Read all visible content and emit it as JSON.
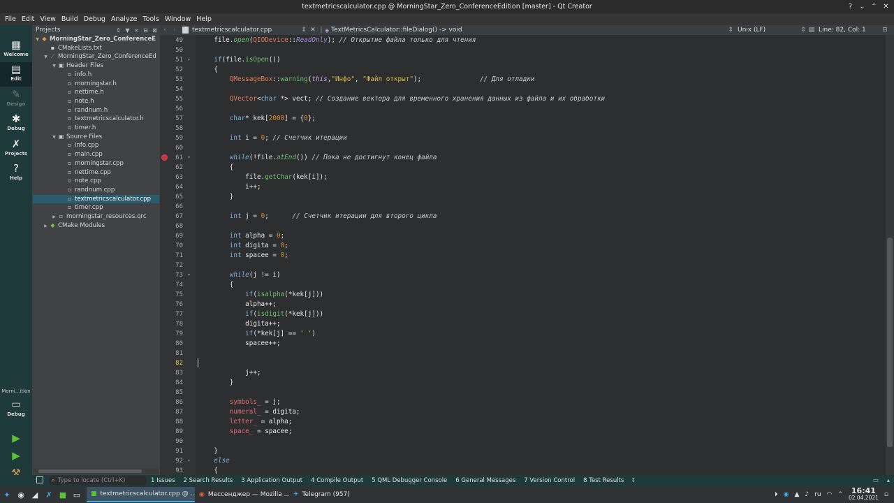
{
  "window": {
    "title": "textmetricscalculator.cpp @ MorningStar_Zero_ConferenceEdition [master] - Qt Creator"
  },
  "menu": [
    "File",
    "Edit",
    "View",
    "Build",
    "Debug",
    "Analyze",
    "Tools",
    "Window",
    "Help"
  ],
  "modes": {
    "welcome": "Welcome",
    "edit": "Edit",
    "design": "Design",
    "debug": "Debug",
    "projects": "Projects",
    "help": "Help"
  },
  "kit": {
    "label": "Morni...ition",
    "debug": "Debug"
  },
  "projects_header": "Projects",
  "tree": [
    {
      "label": "MorningStar_Zero_ConferenceE",
      "depth": 0,
      "arrow": "down",
      "icon": "project-icon",
      "bold": true
    },
    {
      "label": "CMakeLists.txt",
      "depth": 1,
      "arrow": "",
      "icon": "file-icon"
    },
    {
      "label": "MorningStar_Zero_ConferenceEd",
      "depth": 1,
      "arrow": "down",
      "icon": "target-icon"
    },
    {
      "label": "Header Files",
      "depth": 2,
      "arrow": "down",
      "icon": "folder-icon"
    },
    {
      "label": "info.h",
      "depth": 3,
      "arrow": "",
      "icon": "header-file-icon"
    },
    {
      "label": "morningstar.h",
      "depth": 3,
      "arrow": "",
      "icon": "header-file-icon"
    },
    {
      "label": "nettime.h",
      "depth": 3,
      "arrow": "",
      "icon": "header-file-icon"
    },
    {
      "label": "note.h",
      "depth": 3,
      "arrow": "",
      "icon": "header-file-icon"
    },
    {
      "label": "randnum.h",
      "depth": 3,
      "arrow": "",
      "icon": "header-file-icon"
    },
    {
      "label": "textmetricscalculator.h",
      "depth": 3,
      "arrow": "",
      "icon": "header-file-icon"
    },
    {
      "label": "timer.h",
      "depth": 3,
      "arrow": "",
      "icon": "header-file-icon"
    },
    {
      "label": "Source Files",
      "depth": 2,
      "arrow": "down",
      "icon": "folder-icon"
    },
    {
      "label": "info.cpp",
      "depth": 3,
      "arrow": "",
      "icon": "source-file-icon"
    },
    {
      "label": "main.cpp",
      "depth": 3,
      "arrow": "",
      "icon": "source-file-icon"
    },
    {
      "label": "morningstar.cpp",
      "depth": 3,
      "arrow": "",
      "icon": "source-file-icon"
    },
    {
      "label": "nettime.cpp",
      "depth": 3,
      "arrow": "",
      "icon": "source-file-icon"
    },
    {
      "label": "note.cpp",
      "depth": 3,
      "arrow": "",
      "icon": "source-file-icon"
    },
    {
      "label": "randnum.cpp",
      "depth": 3,
      "arrow": "",
      "icon": "source-file-icon"
    },
    {
      "label": "textmetricscalculator.cpp",
      "depth": 3,
      "arrow": "",
      "icon": "source-file-icon",
      "selected": true
    },
    {
      "label": "timer.cpp",
      "depth": 3,
      "arrow": "",
      "icon": "source-file-icon"
    },
    {
      "label": "morningstar_resources.qrc",
      "depth": 2,
      "arrow": "right",
      "icon": "resource-file-icon"
    },
    {
      "label": "CMake Modules",
      "depth": 1,
      "arrow": "right",
      "icon": "cmake-icon"
    }
  ],
  "editor_header": {
    "file": "textmetricscalculator.cpp",
    "function": "TextMetricsCalculator::fileDialog() -> void",
    "encoding": "Unix (LF)",
    "position": "Line: 82, Col: 1"
  },
  "code": {
    "current_line": 82,
    "breakpoint_line": 61,
    "lines": [
      {
        "no": 49,
        "fold": "",
        "html": "    <span class=\"mem\">file</span>.<span class=\"fni\">open</span>(<span class=\"ty\">QIODevice</span>::<span class=\"enum\">ReadOnly</span>); <span class=\"c\">// Открытие файла только для чтения</span>"
      },
      {
        "no": 50,
        "fold": "",
        "html": ""
      },
      {
        "no": 51,
        "fold": "▾",
        "html": "    <span class=\"kw\">if</span>(<span class=\"mem\">file</span>.<span class=\"fn\">isOpen</span>())"
      },
      {
        "no": 52,
        "fold": "",
        "html": "    {"
      },
      {
        "no": 53,
        "fold": "",
        "html": "        <span class=\"ty\">QMessageBox</span>::<span class=\"fn\">warning</span>(<span class=\"th2\">this</span>,<span class=\"s\">\"Инфо\"</span>, <span class=\"s\">\"Файл открыт\"</span>);               <span class=\"c\">// Для отладки</span>"
      },
      {
        "no": 54,
        "fold": "",
        "html": ""
      },
      {
        "no": 55,
        "fold": "",
        "html": "        <span class=\"ty\">QVector</span>&lt;<span class=\"kw\">char</span> *&gt; vect; <span class=\"c\">// Создание вектора для временного хранения данных из файла и их обработки</span>"
      },
      {
        "no": 56,
        "fold": "",
        "html": ""
      },
      {
        "no": 57,
        "fold": "",
        "html": "        <span class=\"kw\">char</span>* kek[<span class=\"n\">2000</span>] = {<span class=\"n\">0</span>};"
      },
      {
        "no": 58,
        "fold": "",
        "html": ""
      },
      {
        "no": 59,
        "fold": "",
        "html": "        <span class=\"kw\">int</span> i = <span class=\"n\">0</span>; <span class=\"c\">// Счетчик итерации</span>"
      },
      {
        "no": 60,
        "fold": "",
        "html": ""
      },
      {
        "no": 61,
        "fold": "▾",
        "html": "        <span class=\"ki\">while</span>(!<span class=\"mem\">file</span>.<span class=\"fni\">atEnd</span>()) <span class=\"c\">// Пока не достигнут конец файла</span>"
      },
      {
        "no": 62,
        "fold": "",
        "html": "        {"
      },
      {
        "no": 63,
        "fold": "",
        "html": "            <span class=\"mem\">file</span>.<span class=\"fn\">getChar</span>(kek[i]);"
      },
      {
        "no": 64,
        "fold": "",
        "html": "            i++;"
      },
      {
        "no": 65,
        "fold": "",
        "html": "        }"
      },
      {
        "no": 66,
        "fold": "",
        "html": ""
      },
      {
        "no": 67,
        "fold": "",
        "html": "        <span class=\"kw\">int</span> j = <span class=\"n\">0</span>;      <span class=\"c\">// Счетчик итерации для второго цикла</span>"
      },
      {
        "no": 68,
        "fold": "",
        "html": ""
      },
      {
        "no": 69,
        "fold": "",
        "html": "        <span class=\"kw\">int</span> alpha = <span class=\"n\">0</span>;"
      },
      {
        "no": 70,
        "fold": "",
        "html": "        <span class=\"kw\">int</span> digita = <span class=\"n\">0</span>;"
      },
      {
        "no": 71,
        "fold": "",
        "html": "        <span class=\"kw\">int</span> spacee = <span class=\"n\">0</span>;"
      },
      {
        "no": 72,
        "fold": "",
        "html": ""
      },
      {
        "no": 73,
        "fold": "▾",
        "html": "        <span class=\"ki\">while</span>(j != i)"
      },
      {
        "no": 74,
        "fold": "",
        "html": "        {"
      },
      {
        "no": 75,
        "fold": "",
        "html": "            <span class=\"kw\">if</span>(<span class=\"fn\">isalpha</span>(*kek[j]))"
      },
      {
        "no": 76,
        "fold": "",
        "html": "            alpha++;"
      },
      {
        "no": 77,
        "fold": "",
        "html": "            <span class=\"kw\">if</span>(<span class=\"fn\">isdigit</span>(*kek[j]))"
      },
      {
        "no": 78,
        "fold": "",
        "html": "            digita++;"
      },
      {
        "no": 79,
        "fold": "",
        "html": "            <span class=\"kw\">if</span>(*kek[j] == <span class=\"s\">' '</span>)"
      },
      {
        "no": 80,
        "fold": "",
        "html": "            spacee++;"
      },
      {
        "no": 81,
        "fold": "",
        "html": ""
      },
      {
        "no": 82,
        "fold": "",
        "html": ""
      },
      {
        "no": 83,
        "fold": "",
        "html": "            j++;"
      },
      {
        "no": 84,
        "fold": "",
        "html": "        }"
      },
      {
        "no": 85,
        "fold": "",
        "html": ""
      },
      {
        "no": 86,
        "fold": "",
        "html": "        <span class=\"ty2\">symbols_</span> = j;"
      },
      {
        "no": 87,
        "fold": "",
        "html": "        <span class=\"ty2\">numeral_</span> = digita;"
      },
      {
        "no": 88,
        "fold": "",
        "html": "        <span class=\"ty2\">letter_</span> = alpha;"
      },
      {
        "no": 89,
        "fold": "",
        "html": "        <span class=\"ty2\">space_</span> = spacee;"
      },
      {
        "no": 90,
        "fold": "",
        "html": ""
      },
      {
        "no": 91,
        "fold": "",
        "html": "    }"
      },
      {
        "no": 92,
        "fold": "▾",
        "html": "    <span class=\"ki\">else</span>"
      },
      {
        "no": 93,
        "fold": "",
        "html": "    {"
      }
    ]
  },
  "status": {
    "locator_placeholder": "Type to locate (Ctrl+K)",
    "outputs": [
      "1 Issues",
      "2 Search Results",
      "3 Application Output",
      "4 Compile Output",
      "5 QML Debugger Console",
      "6 General Messages",
      "7 Version Control",
      "8 Test Results"
    ]
  },
  "taskbar": {
    "tasks": [
      {
        "label": "textmetricscalculator.cpp @ ...",
        "active": true
      },
      {
        "label": "Мессенджер — Mozilla ...",
        "active": false
      },
      {
        "label": "Telegram (957)",
        "active": false
      }
    ],
    "lang": "ru",
    "time": "16:41",
    "date": "02.04.2021"
  }
}
